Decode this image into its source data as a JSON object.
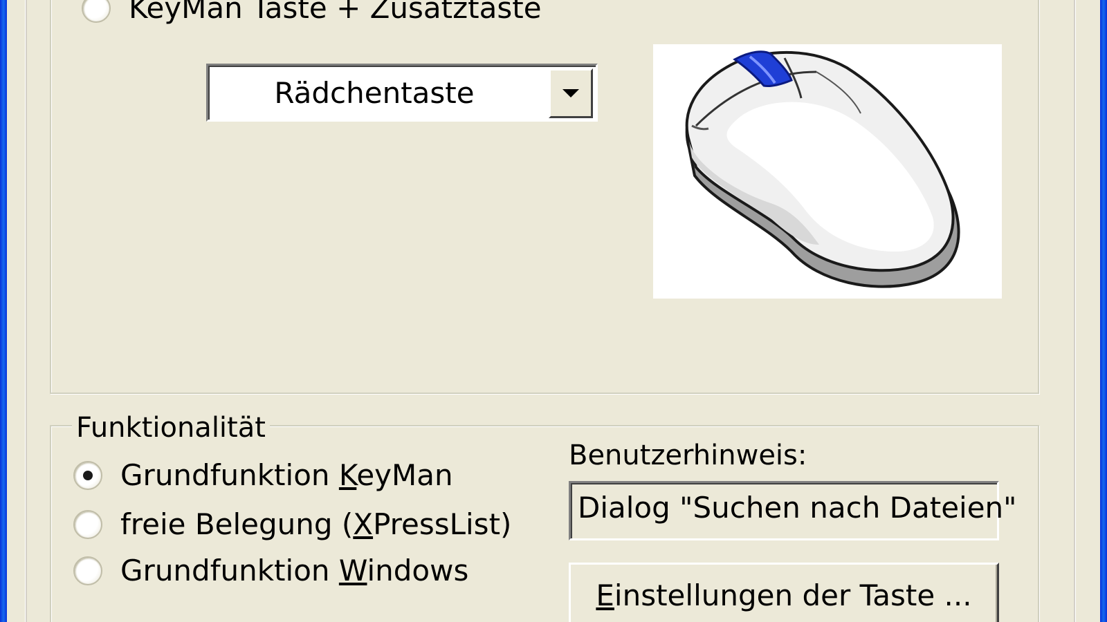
{
  "key_group": {
    "partial_radio_label": "KeyMan Taste + Zusatztaste",
    "button_select": {
      "selected": "Rädchentaste"
    },
    "image_icon": "mouse-icon"
  },
  "function_group": {
    "title": "Funktionalität",
    "options": [
      {
        "label_pre": "Grundfunktion ",
        "accel": "K",
        "label_post": "eyMan",
        "checked": true
      },
      {
        "label_pre": "freie Belegung (",
        "accel": "X",
        "label_post": "PressList)",
        "checked": false
      },
      {
        "label_pre": "Grundfunktion ",
        "accel": "W",
        "label_post": "indows",
        "checked": false
      }
    ],
    "hint_label": "Benutzerhinweis:",
    "hint_value": "Dialog \"Suchen nach Dateien\"",
    "settings_button": {
      "accel": "E",
      "rest": "instellungen der Taste ..."
    }
  },
  "colors": {
    "dialog_bg": "#ece9d8",
    "xp_blue": "#0831d9",
    "mouse_button_highlight": "#1f3fd6"
  }
}
